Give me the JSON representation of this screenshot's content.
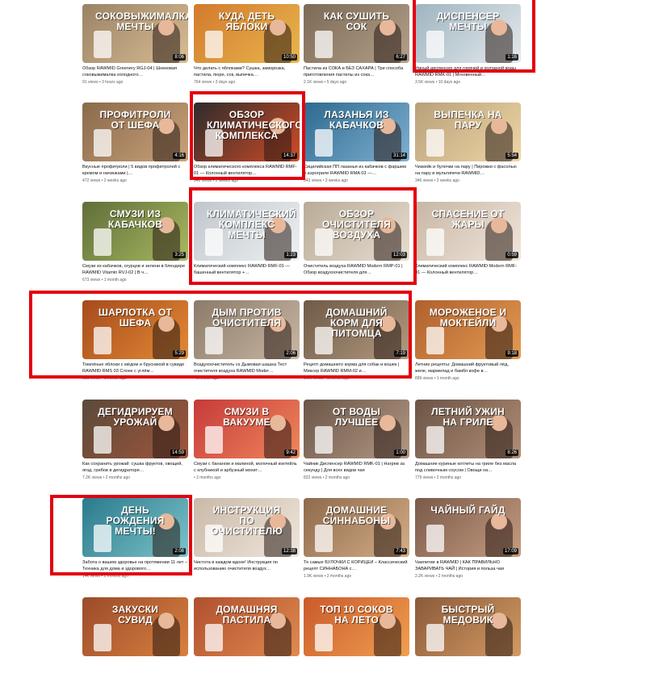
{
  "videos": [
    {
      "thumb_title": "СОКОВЫЖИМАЛКА МЕЧТЫ",
      "duration": "8:06",
      "title": "Обзор RAWMID Greenery RGJ-04 | Шнековая соковыжималка холодного…",
      "views": "91 views",
      "age": "3 hours ago",
      "bg1": "#9a8366",
      "bg2": "#d8bc93"
    },
    {
      "thumb_title": "КУДА ДЕТЬ ЯБЛОКИ",
      "duration": "10:50",
      "title": "Что делать с яблоками? Сушка, заморозка, пастила, пюре, сок, выпечка…",
      "views": "764 views",
      "age": "3 days ago",
      "bg1": "#d27a2e",
      "bg2": "#e9b64c"
    },
    {
      "thumb_title": "КАК СУШИТЬ СОК",
      "duration": "6:27",
      "title": "Пастила из СОКА и БЕЗ САХАРА | Три способа приготовления пастилы из сока…",
      "views": "2.1K views",
      "age": "5 days ago",
      "bg1": "#7d6a56",
      "bg2": "#b3a08a"
    },
    {
      "thumb_title": "ДИСПЕНСЕР МЕЧТЫ",
      "duration": "1:16",
      "title": "Умный диспенсер для горячей и холодной воды RAWMID RMK-01 | Мгновенный…",
      "views": "3.5K views",
      "age": "10 days ago",
      "bg1": "#9fb4c0",
      "bg2": "#e4e9ec"
    },
    {
      "thumb_title": "ПРОФИТРОЛИ ОТ ШЕФА",
      "duration": "4:16",
      "title": "Вкусные профитроли | 5 видов профитролей с кремом и начинками |…",
      "views": "472 views",
      "age": "2 weeks ago",
      "bg1": "#8a6a4b",
      "bg2": "#c9a27a"
    },
    {
      "thumb_title": "ОБЗОР КЛИМАТИЧЕСКОГО КОМПЛЕКСА",
      "duration": "14:37",
      "title": "Обзор климатического комплекса RAWMID RMF-01 — Колонный вентилятор…",
      "views": "940 views",
      "age": "2 weeks ago",
      "bg1": "#2c2c2c",
      "bg2": "#d14b26"
    },
    {
      "thumb_title": "ЛАЗАНЬЯ ИЗ КАБАЧКОВ",
      "duration": "31:14",
      "title": "Сицилийская ПП лазанья из кабачков с фаршем в аэрогриле RAWMID RMA 03 —…",
      "views": "343 views",
      "age": "3 weeks ago",
      "bg1": "#2d6a8f",
      "bg2": "#7fb0d1"
    },
    {
      "thumb_title": "ВЫПЕЧКА НА ПАРУ",
      "duration": "5:54",
      "title": "Чизкейк и булочки на пару | Пирожки с фасолью на пару в мультипечи RAWMID…",
      "views": "346 views",
      "age": "2 weeks ago",
      "bg1": "#b8a07c",
      "bg2": "#efd6a4"
    },
    {
      "thumb_title": "СМУЗИ ИЗ КАБАЧКОВ",
      "duration": "3:25",
      "title": "Смузи из кабачков, огурцов и зелени в блендере RAWMID Vitamin RVJ-02 | В ч…",
      "views": "673 views",
      "age": "1 month ago",
      "bg1": "#5f6e3a",
      "bg2": "#a8b960"
    },
    {
      "thumb_title": "КЛИМАТИЧЕСКИЙ КОМПЛЕКС МЕЧТЫ",
      "duration": "1:23",
      "title": "Климатический комплекс RAWMID RMF-01 — башенный вентилятор +…",
      "views": "",
      "age": "",
      "bg1": "#bfc6cc",
      "bg2": "#eef1f3"
    },
    {
      "thumb_title": "ОБЗОР ОЧИСТИТЕЛЯ ВОЗДУХА",
      "duration": "12:03",
      "title": "Очиститель воздуха RAWMID Modern RMP-01 | Обзор воздухоочистителя для…",
      "views": "",
      "age": "",
      "bg1": "#b9ab97",
      "bg2": "#e6ddd0"
    },
    {
      "thumb_title": "СПАСЕНИЕ ОТ ЖАРЫ",
      "duration": "0:59",
      "title": "Климатический комплекс RAWMID Modern RMF-01 — Колонный вентилятор…",
      "views": "",
      "age": "",
      "bg1": "#c7b6a5",
      "bg2": "#f1e6da"
    },
    {
      "thumb_title": "ШАРЛОТКА ОТ ШЕФА",
      "duration": "5:29",
      "title": "Томлёные яблоки с мёдом и брусникой в сувиде RAWMID RMS 03 Слоек с углём…",
      "views": "586 views",
      "age": "1 month ago",
      "bg1": "#a64b1c",
      "bg2": "#e38a35"
    },
    {
      "thumb_title": "ДЫМ ПРОТИВ ОЧИСТИТЕЛЯ",
      "duration": "2:06",
      "title": "Воздухоочиститель vs Дымовая шашка Тест очистителя воздуха RAWMID Moder…",
      "views": "",
      "age": "1 month ago",
      "bg1": "#8c7b6a",
      "bg2": "#c9b6a3"
    },
    {
      "thumb_title": "ДОМАШНИЙ КОРМ ДЛЯ ПИТОМЦА",
      "duration": "7:19",
      "title": "Рецепт домашнего корма для собак и кошек | Миксер RAWMID RMM-02 и…",
      "views": "1.9K views",
      "age": "1 month ago",
      "bg1": "#6f5a48",
      "bg2": "#b39a7f"
    },
    {
      "thumb_title": "МОРОЖЕНОЕ И МОКТЕЙЛИ",
      "duration": "9:18",
      "title": "Летние рецепты: Домашний фруктовый лёд, желе, мармелад и бамбл кофе в…",
      "views": "899 views",
      "age": "1 month ago",
      "bg1": "#b0602e",
      "bg2": "#e39b52"
    },
    {
      "thumb_title": "ДЕГИДРИРУЕМ УРОЖАЙ",
      "duration": "14:59",
      "title": "Как сохранить урожай: сушка фруктов, овощей, ягод, грибов в дегидраторе…",
      "views": "7.2K views",
      "age": "2 months ago",
      "bg1": "#5a4a3a",
      "bg2": "#a0553b"
    },
    {
      "thumb_title": "СМУЗИ В ВАКУУМЕ",
      "duration": "9:42",
      "title": "Смузи с бананом и малиной, молочный коктейль с клубникой и арбузный мохит…",
      "views": "",
      "age": "2 months ago",
      "bg1": "#c63a3a",
      "bg2": "#f0875c"
    },
    {
      "thumb_title": "ОТ ВОДЫ ЛУЧШЕЕ",
      "duration": "1:00",
      "title": "Чайник Диспенсер RAWMID RMK-01 | Нагрев за секунду | Для всех видов чая",
      "views": "822 views",
      "age": "2 months ago",
      "bg1": "#6a5648",
      "bg2": "#b49884"
    },
    {
      "thumb_title": "ЛЕТНИЙ УЖИН НА ГРИЛЕ",
      "duration": "8:26",
      "title": "Домашние куриные котлеты на гриле без масла под сливочным соусом | Овощи на…",
      "views": "779 views",
      "age": "2 months ago",
      "bg1": "#6b5446",
      "bg2": "#b28e76"
    },
    {
      "thumb_title": "ДЕНЬ РОЖДЕНИЯ МЕЧТЫ!",
      "duration": "2:08",
      "title": "Забота о вашем здоровье на протяжении 11 лет – Техника для дома и здорового…",
      "views": "14k views",
      "age": "2 months ago",
      "bg1": "#2a7a8c",
      "bg2": "#7cc3c9"
    },
    {
      "thumb_title": "ИНСТРУКЦИЯ ПО ОЧИСТИТЕЛЮ",
      "duration": "12:38",
      "title": "Чистота в каждом вдохе! Инструкция по использованию очистителя воздух…",
      "views": "",
      "age": "",
      "bg1": "#c9b9a8",
      "bg2": "#efe6db"
    },
    {
      "thumb_title": "ДОМАШНИЕ СИННАБОНЫ",
      "duration": "7:43",
      "title": "Те самые БУЛОЧКИ С КОРИЦЕЙ – Классический рецепт СИННАБОНА с…",
      "views": "1.9K views",
      "age": "2 months ago",
      "bg1": "#8f6a4c",
      "bg2": "#d4ae86"
    },
    {
      "thumb_title": "ЧАЙНЫЙ ГАЙД",
      "duration": "17:09",
      "title": "Чаепитие в RAWMID | КАК ПРАВИЛЬНО ЗАВАРИВАТЬ ЧАЙ | История и польза чая",
      "views": "2.2K views",
      "age": "2 months ago",
      "bg1": "#7a5a4a",
      "bg2": "#c69c80"
    },
    {
      "thumb_title": "ЗАКУСКИ СУВИД",
      "duration": "",
      "title": "",
      "views": "",
      "age": "",
      "bg1": "#9b4b2a",
      "bg2": "#d9803f"
    },
    {
      "thumb_title": "ДОМАШНЯЯ ПАСТИЛА",
      "duration": "",
      "title": "",
      "views": "",
      "age": "",
      "bg1": "#b0502f",
      "bg2": "#e08a4f"
    },
    {
      "thumb_title": "ТОП 10 СОКОВ НА ЛЕТО",
      "duration": "",
      "title": "",
      "views": "",
      "age": "",
      "bg1": "#c95a2b",
      "bg2": "#f0a050"
    },
    {
      "thumb_title": "БЫСТРЫЙ МЕДОВИК",
      "duration": "",
      "title": "",
      "views": "",
      "age": "",
      "bg1": "#8a5a3a",
      "bg2": "#d39a62"
    }
  ],
  "colors": {
    "highlight": "#e3000f",
    "accent_green": "#1fa34a"
  }
}
